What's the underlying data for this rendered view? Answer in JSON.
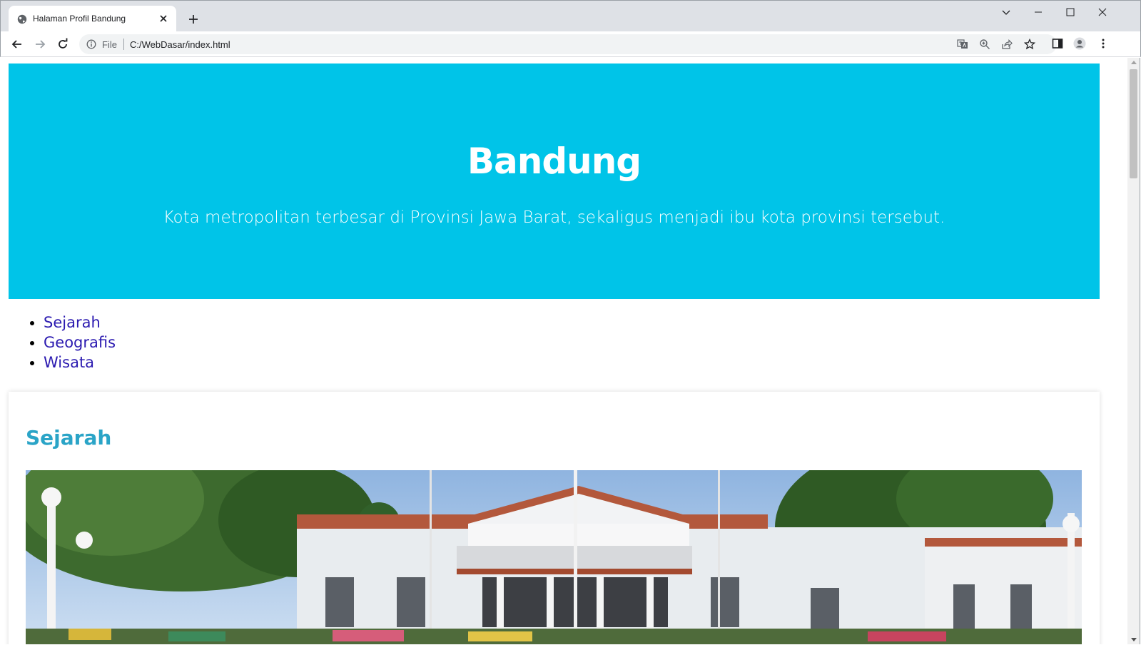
{
  "browser": {
    "tab_title": "Halaman Profil Bandung",
    "scheme_label": "File",
    "url": "C:/WebDasar/index.html"
  },
  "icons": {
    "favicon": "globe-icon",
    "tab_close": "close-icon",
    "new_tab": "plus-icon",
    "tab_search": "chevron-down-icon",
    "minimize": "minimize-icon",
    "maximize": "maximize-icon",
    "close_window": "close-icon",
    "back": "arrow-left-icon",
    "forward": "arrow-right-icon",
    "reload": "reload-icon",
    "site_info": "info-icon",
    "translate": "translate-icon",
    "zoom": "zoom-icon",
    "share": "share-icon",
    "bookmark": "star-icon",
    "side_panel": "side-panel-icon",
    "profile": "avatar-icon",
    "menu": "kebab-menu-icon"
  },
  "colors": {
    "hero_background": "#00c4e8",
    "section_heading": "#2aa4c7",
    "link": "#2b1ab0"
  },
  "page": {
    "hero": {
      "title": "Bandung",
      "subtitle": "Kota metropolitan terbesar di Provinsi Jawa Barat, sekaligus menjadi ibu kota provinsi tersebut."
    },
    "nav": [
      "Sejarah",
      "Geografis",
      "Wisata"
    ],
    "section": {
      "title": "Sejarah"
    }
  }
}
